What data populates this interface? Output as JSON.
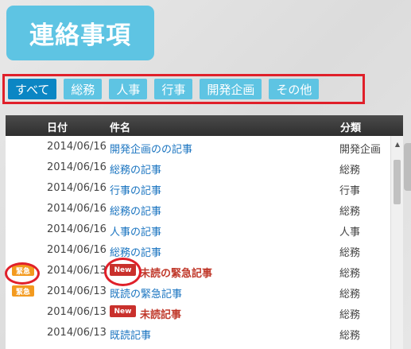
{
  "page": {
    "title": "連絡事項"
  },
  "filters": [
    {
      "label": "すべて",
      "active": true
    },
    {
      "label": "総務",
      "active": false
    },
    {
      "label": "人事",
      "active": false
    },
    {
      "label": "行事",
      "active": false
    },
    {
      "label": "開発企画",
      "active": false
    },
    {
      "label": "その他",
      "active": false
    }
  ],
  "table": {
    "columns": {
      "date": "日付",
      "title": "件名",
      "category": "分類"
    },
    "rows": [
      {
        "urgent": false,
        "new": false,
        "date": "2014/06/16",
        "title": "開発企画のの記事",
        "category": "開発企画"
      },
      {
        "urgent": false,
        "new": false,
        "date": "2014/06/16",
        "title": "総務の記事",
        "category": "総務"
      },
      {
        "urgent": false,
        "new": false,
        "date": "2014/06/16",
        "title": "行事の記事",
        "category": "行事"
      },
      {
        "urgent": false,
        "new": false,
        "date": "2014/06/16",
        "title": "総務の記事",
        "category": "総務"
      },
      {
        "urgent": false,
        "new": false,
        "date": "2014/06/16",
        "title": "人事の記事",
        "category": "人事"
      },
      {
        "urgent": false,
        "new": false,
        "date": "2014/06/16",
        "title": "総務の記事",
        "category": "総務"
      },
      {
        "urgent": true,
        "new": true,
        "date": "2014/06/13",
        "title": "未読の緊急記事",
        "category": "総務"
      },
      {
        "urgent": true,
        "new": false,
        "date": "2014/06/13",
        "title": "既読の緊急記事",
        "category": "総務"
      },
      {
        "urgent": false,
        "new": true,
        "date": "2014/06/13",
        "title": "未読記事",
        "category": "総務"
      },
      {
        "urgent": false,
        "new": false,
        "date": "2014/06/13",
        "title": "既読記事",
        "category": "総務"
      }
    ]
  },
  "badges": {
    "urgent_label": "緊急",
    "new_label": "New"
  },
  "colors": {
    "accent": "#5ec4e3",
    "active_filter": "#0b86c4",
    "highlight": "#e0202a",
    "urgent_badge": "#f39a1f",
    "new_badge": "#c9302c",
    "link": "#1a74c0"
  }
}
